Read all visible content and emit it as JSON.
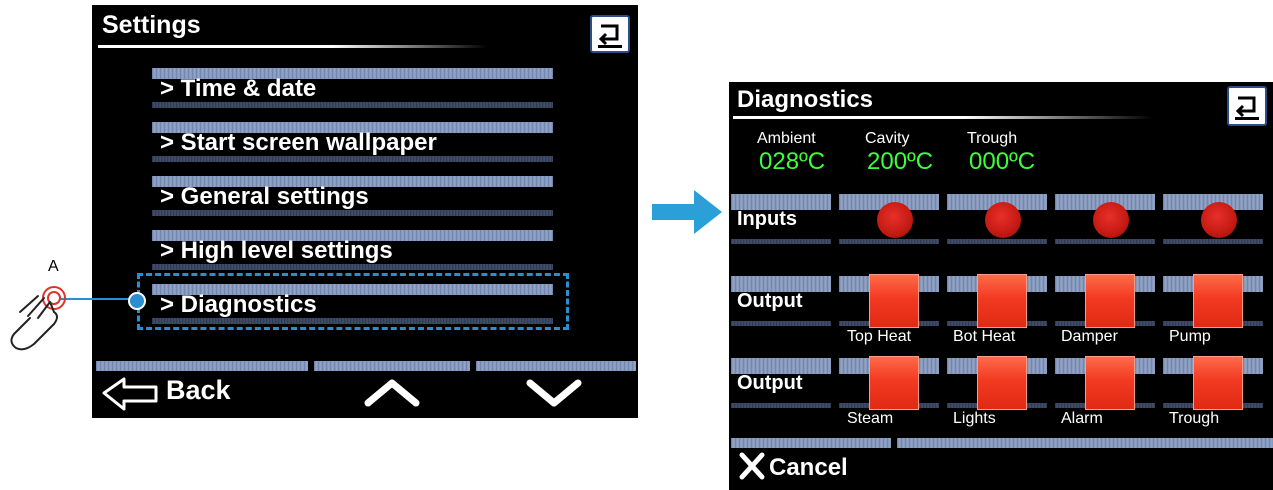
{
  "left_screen": {
    "title": "Settings",
    "menu": [
      {
        "label": "> Time & date"
      },
      {
        "label": "> Start screen wallpaper"
      },
      {
        "label": "> General settings"
      },
      {
        "label": "> High level settings"
      },
      {
        "label": "> Diagnostics"
      }
    ],
    "footer": {
      "back_label": "Back"
    }
  },
  "annotation": {
    "marker": "A"
  },
  "right_screen": {
    "title": "Diagnostics",
    "temps": [
      {
        "label": "Ambient",
        "value": "028ºC"
      },
      {
        "label": "Cavity",
        "value": "200ºC"
      },
      {
        "label": "Trough",
        "value": "000ºC"
      }
    ],
    "rows": {
      "inputs": "Inputs",
      "output1": "Output",
      "output2": "Output"
    },
    "output1_labels": [
      "Top Heat",
      "Bot Heat",
      "Damper",
      "Pump"
    ],
    "output2_labels": [
      "Steam",
      "Lights",
      "Alarm",
      "Trough"
    ],
    "cancel_label": "Cancel"
  },
  "colors": {
    "accent": "#2a8fd0",
    "led_red": "#c31a12",
    "button_red": "#f23a22",
    "temp_green": "#3cff3c"
  }
}
